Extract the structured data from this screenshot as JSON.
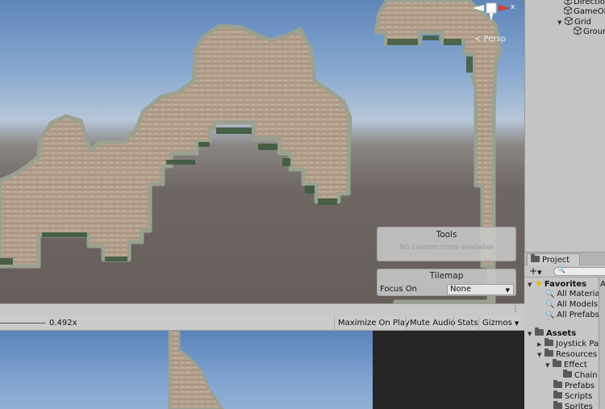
{
  "scene": {
    "persp_label": "< Persp",
    "gizmo_axis_label": "x",
    "tools_panel": {
      "title": "Tools",
      "subtitle": "No custom tools available"
    },
    "tilemap_panel": {
      "title": "Tilemap",
      "focus_label": "Focus On",
      "focus_value": "None"
    }
  },
  "game_toolbar": {
    "scale_value": "0.492x",
    "maximize_label": "Maximize On Play",
    "mute_label": "Mute Audio",
    "stats_label": "Stats",
    "gizmos_label": "Gizmos"
  },
  "hierarchy": {
    "items": [
      {
        "label": "Directio",
        "indent": 1
      },
      {
        "label": "GameOb",
        "indent": 1
      },
      {
        "label": "Grid",
        "indent": 0,
        "expanded": true
      },
      {
        "label": "Groun",
        "indent": 1
      }
    ]
  },
  "project": {
    "tab_label": "Project",
    "side_letter": "A",
    "favorites_label": "Favorites",
    "favorites": [
      "All Materia",
      "All Models",
      "All Prefabs"
    ],
    "assets_label": "Assets",
    "assets": [
      {
        "label": "Joystick Pa",
        "level": 1,
        "caret": "right"
      },
      {
        "label": "Resources",
        "level": 1,
        "caret": "down"
      },
      {
        "label": "Effect",
        "level": 2,
        "caret": "down"
      },
      {
        "label": "Chain",
        "level": 3,
        "caret": "none"
      },
      {
        "label": "Prefabs",
        "level": 2,
        "caret": "none"
      },
      {
        "label": "Scripts",
        "level": 2,
        "caret": "none"
      },
      {
        "label": "Sprites",
        "level": 2,
        "caret": "none"
      }
    ]
  },
  "colors": {
    "gizmo_x": "#d9382f",
    "favorite_star": "#e6b400",
    "terrain_fill": "#b3a08d",
    "terrain_edge": "#8f9a86",
    "grass": "#3c5139"
  }
}
